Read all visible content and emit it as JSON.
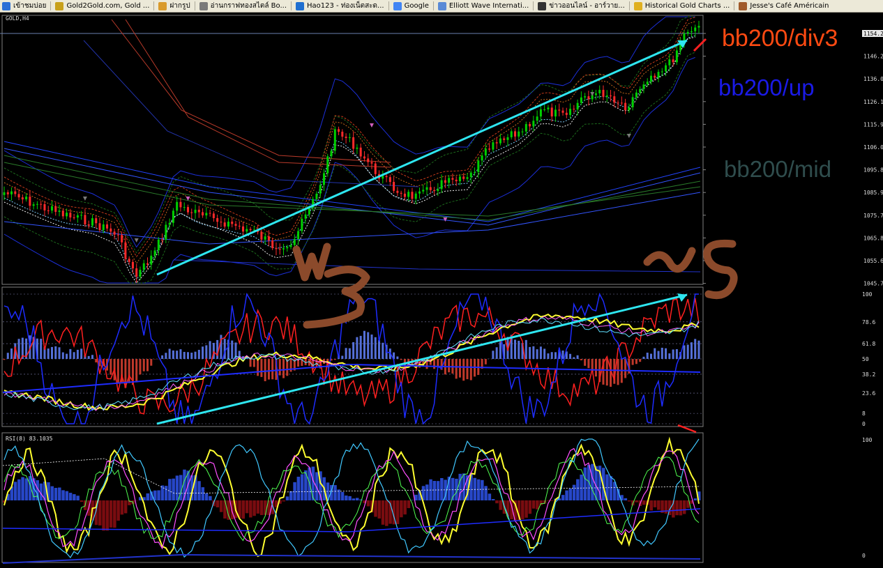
{
  "bookmarks": [
    {
      "label": "เข้าชมบ่อย",
      "icon": "frequent-icon",
      "color": "#2b6fd6"
    },
    {
      "label": "Gold2Gold.com, Gold ...",
      "icon": "gold2gold-icon",
      "color": "#c8a01a"
    },
    {
      "label": "ฝากรูป",
      "icon": "photo-host-icon",
      "color": "#d99a2b"
    },
    {
      "label": "อ่านกราฟทองสไตล์ Bo...",
      "icon": "bookmark-star-icon",
      "color": "#7a7a7a"
    },
    {
      "label": "Hao123 - ท่องเน็ตสะด...",
      "icon": "hao123-icon",
      "color": "#1f6fd0"
    },
    {
      "label": "Google",
      "icon": "google-icon",
      "color": "#4285f4"
    },
    {
      "label": "Elliott Wave Internati...",
      "icon": "globe-icon",
      "color": "#5a8ad6"
    },
    {
      "label": "ข่าวออนไลน์ - อาร์วาย...",
      "icon": "r-icon",
      "color": "#333333"
    },
    {
      "label": "Historical Gold Charts ...",
      "icon": "gold-bar-icon",
      "color": "#e0b020"
    },
    {
      "label": "Jesse's Café Américain",
      "icon": "jesse-icon",
      "color": "#a05a2a"
    }
  ],
  "main_panel": {
    "title_fragment": "GOLD,H4",
    "price_labels": [
      "1154.2",
      "1146.2",
      "1136.0",
      "1126.1",
      "1115.9",
      "1106.0",
      "1095.8",
      "1085.9",
      "1075.7",
      "1065.8",
      "1055.6",
      "1045.7"
    ],
    "annotations": {
      "div3": "bb200/div3",
      "up": "bb200/up",
      "mid": "bb200/mid"
    },
    "annotation_colors": {
      "div3": "#ff4a12",
      "up": "#1a1ae6",
      "mid": "#2f4d4d"
    }
  },
  "stoch_panel": {
    "levels": [
      "100",
      "78.6",
      "61.8",
      "50",
      "38.2",
      "23.6",
      "8",
      "0"
    ]
  },
  "rsi_panel": {
    "label": "RSI(8) 83.1035",
    "levels": [
      "100",
      "0"
    ]
  },
  "colors": {
    "bull": "#00d000",
    "bear": "#ff2a2a",
    "cyan_arrow": "#2ee6f0",
    "brown_mark": "#8b4a2b"
  }
}
